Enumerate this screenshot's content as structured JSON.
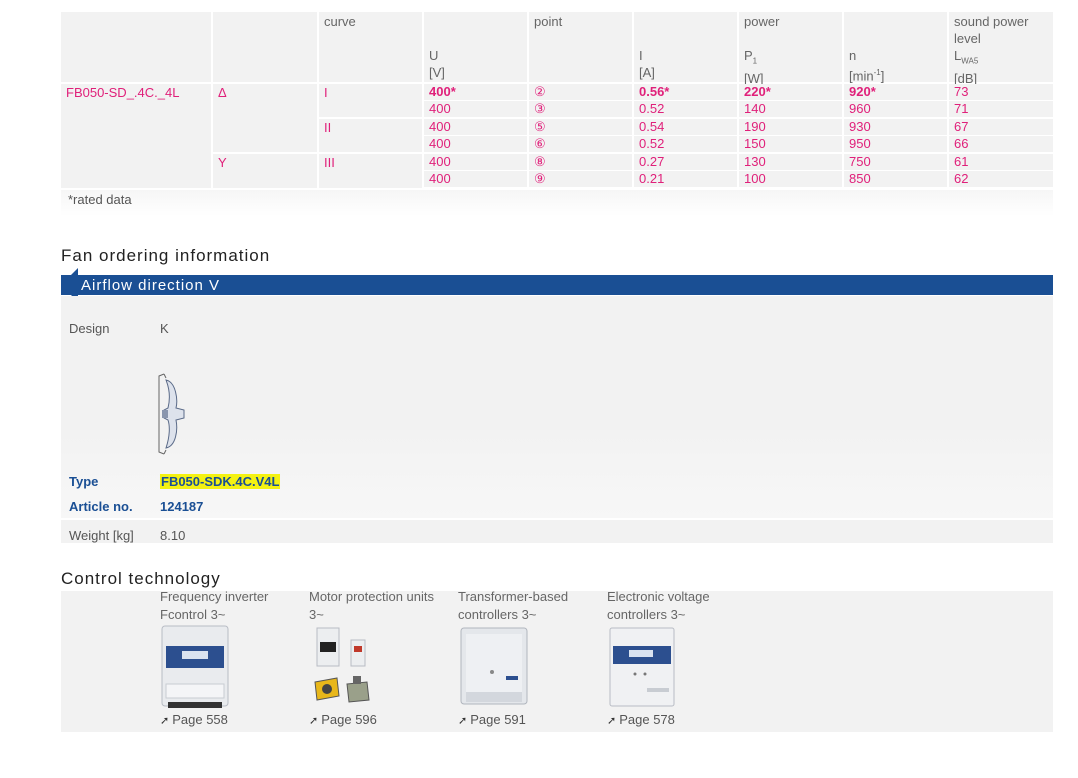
{
  "table": {
    "headers": [
      {
        "top": "",
        "unit_line1": "",
        "unit_line2": ""
      },
      {
        "top": "",
        "unit_line1": "",
        "unit_line2": ""
      },
      {
        "top": "curve",
        "unit_line1": "",
        "unit_line2": ""
      },
      {
        "top": "",
        "unit_line1": "U",
        "unit_line2": "[V]"
      },
      {
        "top": "point",
        "unit_line1": "",
        "unit_line2": ""
      },
      {
        "top": "",
        "unit_line1": "I",
        "unit_line2": "[A]"
      },
      {
        "top": "power",
        "unit_line1": "P",
        "unit_sub": "1",
        "unit_line2": "[W]"
      },
      {
        "top": "",
        "unit_line1": "n",
        "unit_line2": "[min",
        "unit_sup": "-1",
        "unit_end": "]"
      },
      {
        "top": "sound power",
        "top2": "level",
        "unit_line1": "L",
        "unit_sub": "WA5",
        "unit_line2": "[dB]"
      }
    ],
    "model": "FB050-SD_.4C._4L",
    "connections": [
      {
        "label": "Δ"
      },
      {
        "label": "Y"
      }
    ],
    "curves": [
      {
        "label": "I"
      },
      {
        "label": "II"
      },
      {
        "label": "III"
      }
    ],
    "rows": [
      {
        "U": "400*",
        "point": "②",
        "I": "0.56*",
        "P": "220*",
        "n": "920*",
        "L": "73",
        "bold": true
      },
      {
        "U": "400",
        "point": "③",
        "I": "0.52",
        "P": "140",
        "n": "960",
        "L": "71",
        "bold": false
      },
      {
        "U": "400",
        "point": "⑤",
        "I": "0.54",
        "P": "190",
        "n": "930",
        "L": "67",
        "bold": false
      },
      {
        "U": "400",
        "point": "⑥",
        "I": "0.52",
        "P": "150",
        "n": "950",
        "L": "66",
        "bold": false
      },
      {
        "U": "400",
        "point": "⑧",
        "I": "0.27",
        "P": "130",
        "n": "750",
        "L": "61",
        "bold": false
      },
      {
        "U": "400",
        "point": "⑨",
        "I": "0.21",
        "P": "100",
        "n": "850",
        "L": "62",
        "bold": false
      }
    ],
    "footnote": "*rated data"
  },
  "ordering": {
    "title": "Fan ordering information",
    "airflow": "Airflow direction V",
    "design_label": "Design",
    "design_value": "K",
    "type_label": "Type",
    "type_value": "FB050-SDK.4C.V4L",
    "article_label": "Article no.",
    "article_value": "124187",
    "weight_label": "Weight [kg]",
    "weight_value": "8.10"
  },
  "control": {
    "title": "Control technology",
    "items": [
      {
        "line1": "Frequency inverter",
        "line2": "Fcontrol 3~",
        "page": "Page 558"
      },
      {
        "line1": "Motor protection units",
        "line2": "3~",
        "page": "Page 596"
      },
      {
        "line1": "Transformer-based",
        "line2": "controllers 3~",
        "page": "Page 591"
      },
      {
        "line1": "Electronic voltage",
        "line2": "controllers 3~",
        "page": "Page 578"
      }
    ]
  },
  "colors": {
    "accent_magenta": "#e0207a",
    "brand_blue": "#1a4f94",
    "highlight_yellow": "#f4f212",
    "panel_grey": "#f2f2f2"
  }
}
